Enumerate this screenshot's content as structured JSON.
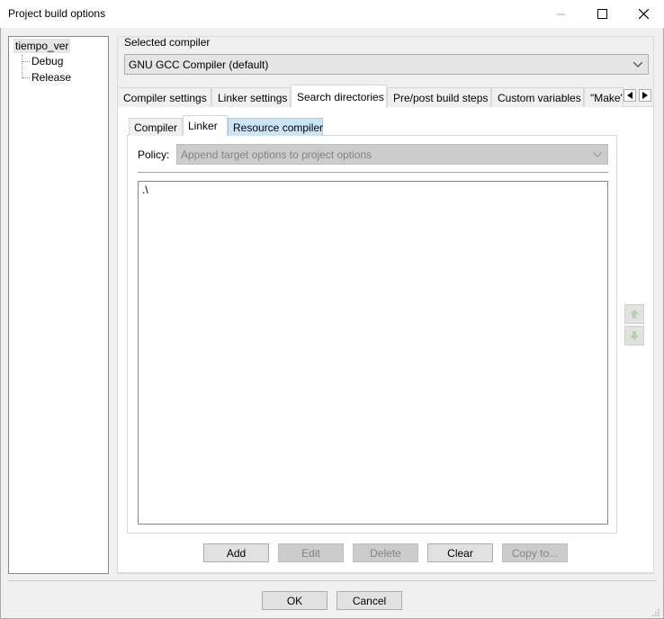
{
  "window": {
    "title": "Project build options"
  },
  "tree": {
    "root": "tiempo_ver",
    "children": [
      "Debug",
      "Release"
    ]
  },
  "compiler": {
    "label": "Selected compiler",
    "value": "GNU GCC Compiler (default)"
  },
  "tabs": [
    "Compiler settings",
    "Linker settings",
    "Search directories",
    "Pre/post build steps",
    "Custom variables",
    "\"Make\""
  ],
  "subtabs": [
    "Compiler",
    "Linker",
    "Resource compiler"
  ],
  "policy": {
    "label": "Policy:",
    "value": "Append target options to project options"
  },
  "list": {
    "items": [
      ".\\"
    ]
  },
  "buttons": {
    "add": "Add",
    "edit": "Edit",
    "delete": "Delete",
    "clear": "Clear",
    "copy": "Copy to..."
  },
  "footer": {
    "ok": "OK",
    "cancel": "Cancel"
  },
  "colors": {
    "active_subtab_bg": "#cce4f7",
    "green_arrow": "#7ac36a"
  }
}
